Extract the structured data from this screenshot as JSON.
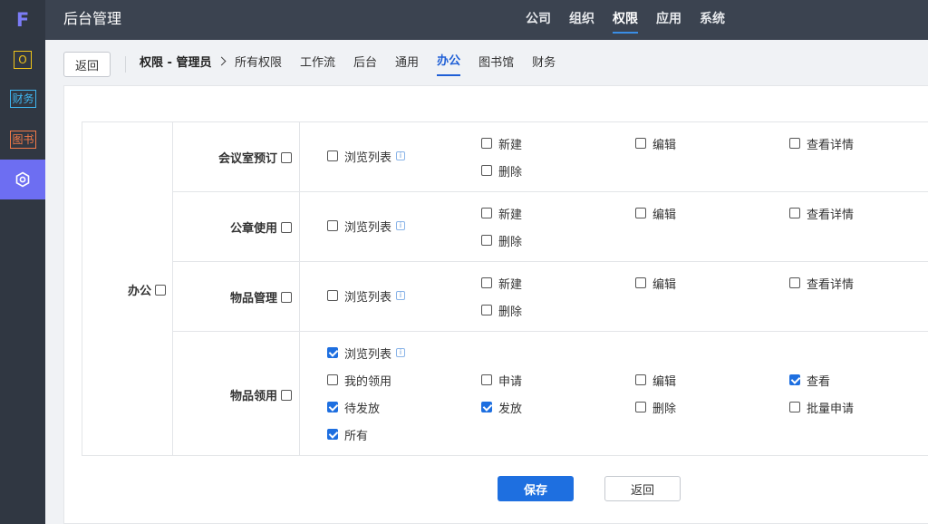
{
  "rail": {
    "logo": "F",
    "tiles": [
      "O",
      "财务",
      "图书"
    ],
    "active_icon": "settings-hex-icon"
  },
  "header": {
    "title": "后台管理",
    "nav": [
      {
        "label": "公司",
        "active": false
      },
      {
        "label": "组织",
        "active": false
      },
      {
        "label": "权限",
        "active": true
      },
      {
        "label": "应用",
        "active": false
      },
      {
        "label": "系统",
        "active": false
      }
    ]
  },
  "toolbar": {
    "back_label": "返回",
    "breadcrumb": "权限 - 管理员",
    "tabs": [
      {
        "label": "所有权限",
        "active": false
      },
      {
        "label": "工作流",
        "active": false
      },
      {
        "label": "后台",
        "active": false
      },
      {
        "label": "通用",
        "active": false
      },
      {
        "label": "办公",
        "active": true
      },
      {
        "label": "图书馆",
        "active": false
      },
      {
        "label": "财务",
        "active": false
      }
    ]
  },
  "permissions": {
    "group": {
      "label": "办公",
      "checked": false
    },
    "rows": [
      {
        "label": "会议室预订",
        "checked": false,
        "options": [
          {
            "label": "浏览列表",
            "checked": false,
            "info": true
          },
          {
            "label": "新建",
            "checked": false
          },
          {
            "label": "编辑",
            "checked": false
          },
          {
            "label": "查看详情",
            "checked": false
          },
          {
            "label": "删除",
            "checked": false
          }
        ]
      },
      {
        "label": "公章使用",
        "checked": false,
        "options": [
          {
            "label": "浏览列表",
            "checked": false,
            "info": true
          },
          {
            "label": "新建",
            "checked": false
          },
          {
            "label": "编辑",
            "checked": false
          },
          {
            "label": "查看详情",
            "checked": false
          },
          {
            "label": "删除",
            "checked": false
          }
        ]
      },
      {
        "label": "物品管理",
        "checked": false,
        "options": [
          {
            "label": "浏览列表",
            "checked": false,
            "info": true
          },
          {
            "label": "新建",
            "checked": false
          },
          {
            "label": "编辑",
            "checked": false
          },
          {
            "label": "查看详情",
            "checked": false
          },
          {
            "label": "删除",
            "checked": false
          }
        ]
      },
      {
        "label": "物品领用",
        "checked": false,
        "options": [
          {
            "label": "浏览列表",
            "checked": true,
            "info": true
          },
          {
            "label": "我的领用",
            "checked": false
          },
          {
            "label": "申请",
            "checked": false
          },
          {
            "label": "编辑",
            "checked": false
          },
          {
            "label": "查看",
            "checked": true
          },
          {
            "label": "待发放",
            "checked": true
          },
          {
            "label": "发放",
            "checked": true
          },
          {
            "label": "删除",
            "checked": false
          },
          {
            "label": "批量申请",
            "checked": false
          },
          {
            "label": "所有",
            "checked": true
          }
        ]
      }
    ]
  },
  "footer": {
    "save_label": "保存",
    "back_label": "返回"
  },
  "colors": {
    "primary": "#1e6fe0",
    "header_bg": "#3b4350",
    "rail_bg": "#303742",
    "rail_active": "#6d6ef2"
  }
}
